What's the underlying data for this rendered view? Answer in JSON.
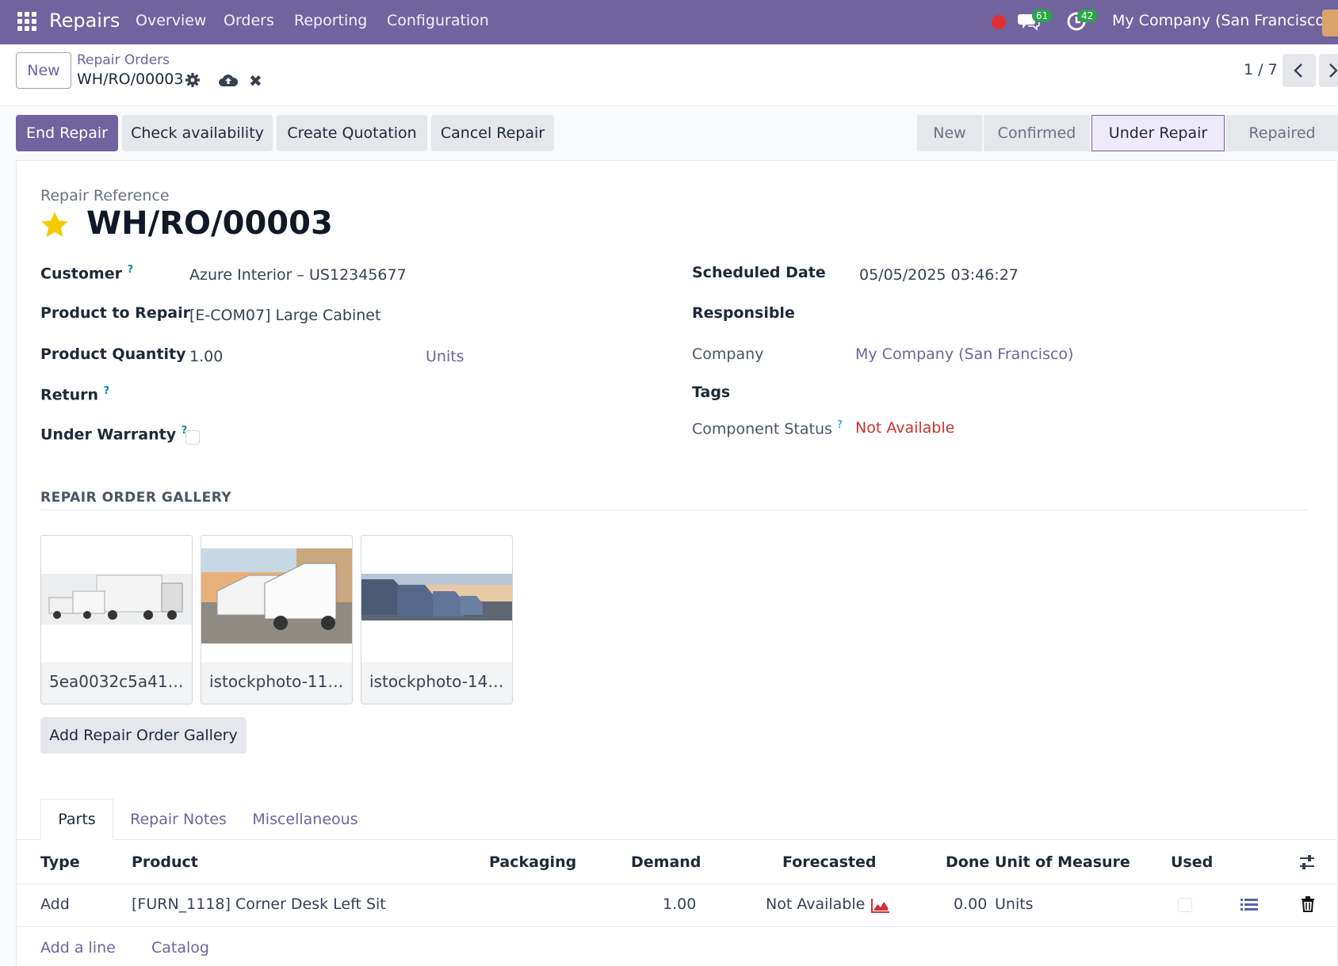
{
  "topbar": {
    "app_name": "Repairs",
    "menu": [
      "Overview",
      "Orders",
      "Reporting",
      "Configuration"
    ],
    "chat_count": "61",
    "activity_count": "42",
    "company": "My Company (San Francisco)"
  },
  "control": {
    "new_label": "New",
    "breadcrumb": "Repair Orders",
    "record_name": "WH/RO/00003",
    "pager": "1 / 7"
  },
  "actions": {
    "end_repair": "End Repair",
    "check_availability": "Check availability",
    "create_quotation": "Create Quotation",
    "cancel_repair": "Cancel Repair"
  },
  "stages": [
    "New",
    "Confirmed",
    "Under Repair",
    "Repaired"
  ],
  "active_stage": "Under Repair",
  "form": {
    "ref_label": "Repair Reference",
    "ref_value": "WH/RO/00003",
    "customer_label": "Customer",
    "customer_value": "Azure Interior – US12345677",
    "product_label": "Product to Repair",
    "product_value": "[E-COM07] Large Cabinet",
    "quantity_label": "Product Quantity",
    "quantity_value": "1.00",
    "quantity_uom": "Units",
    "return_label": "Return",
    "warranty_label": "Under Warranty",
    "scheduled_label": "Scheduled Date",
    "scheduled_value": "05/05/2025 03:46:27",
    "responsible_label": "Responsible",
    "company_label": "Company",
    "company_value": "My Company (San Francisco)",
    "tags_label": "Tags",
    "component_label": "Component Status",
    "component_value": "Not Available"
  },
  "gallery": {
    "title": "REPAIR ORDER GALLERY",
    "items": [
      "5ea0032c5a41…",
      "istockphoto-11…",
      "istockphoto-14…"
    ],
    "add_label": "Add Repair Order Gallery"
  },
  "tabs": [
    "Parts",
    "Repair Notes",
    "Miscellaneous"
  ],
  "parts": {
    "columns": [
      "Type",
      "Product",
      "Packaging",
      "Demand",
      "Forecasted",
      "Done",
      "Unit of Measure",
      "Used"
    ],
    "rows": [
      {
        "type": "Add",
        "product": "[FURN_1118] Corner Desk Left Sit",
        "packaging": "",
        "demand": "1.00",
        "forecasted": "Not Available",
        "done": "0.00",
        "uom": "Units"
      }
    ],
    "add_line": "Add a line",
    "catalog": "Catalog"
  },
  "colors": {
    "brand": "#71639e",
    "danger": "#d03030",
    "badge": "#28a745"
  }
}
